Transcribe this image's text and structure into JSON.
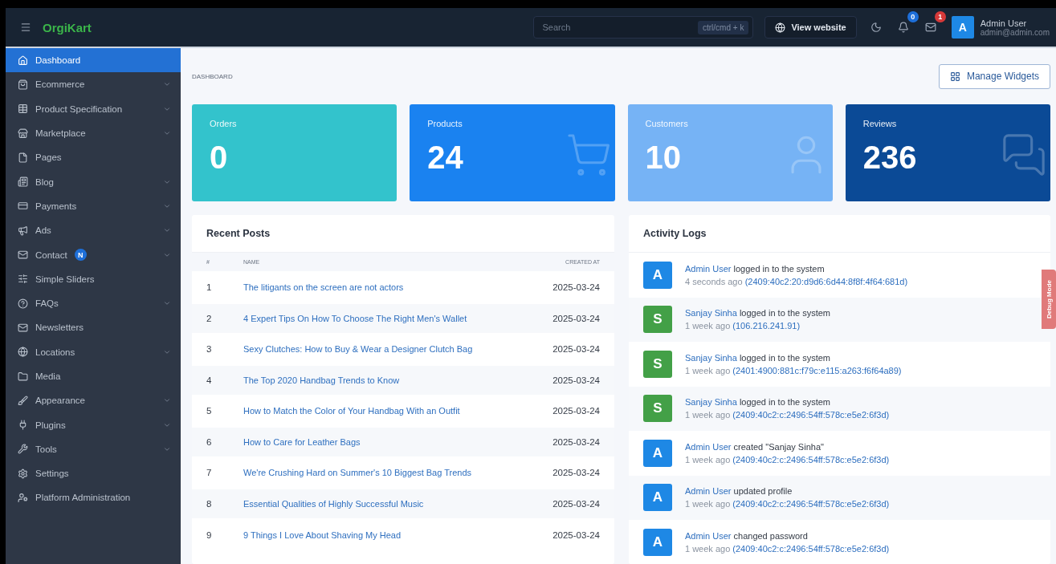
{
  "header": {
    "logo": "OrgiKart",
    "search": {
      "placeholder": "Search",
      "shortcut": "ctrl/cmd + k"
    },
    "view_website": "View website",
    "notifications_badge": "0",
    "messages_badge": "1",
    "user": {
      "avatar": "A",
      "name": "Admin User",
      "email": "admin@admin.com"
    }
  },
  "sidebar": {
    "items": [
      {
        "label": "Dashboard",
        "selected": true,
        "expandable": false
      },
      {
        "label": "Ecommerce",
        "selected": false,
        "expandable": true
      },
      {
        "label": "Product Specification",
        "selected": false,
        "expandable": true
      },
      {
        "label": "Marketplace",
        "selected": false,
        "expandable": true
      },
      {
        "label": "Pages",
        "selected": false,
        "expandable": false
      },
      {
        "label": "Blog",
        "selected": false,
        "expandable": true
      },
      {
        "label": "Payments",
        "selected": false,
        "expandable": true
      },
      {
        "label": "Ads",
        "selected": false,
        "expandable": true
      },
      {
        "label": "Contact",
        "selected": false,
        "expandable": true,
        "badge": "N"
      },
      {
        "label": "Simple Sliders",
        "selected": false,
        "expandable": false
      },
      {
        "label": "FAQs",
        "selected": false,
        "expandable": true
      },
      {
        "label": "Newsletters",
        "selected": false,
        "expandable": false
      },
      {
        "label": "Locations",
        "selected": false,
        "expandable": true
      },
      {
        "label": "Media",
        "selected": false,
        "expandable": false
      },
      {
        "label": "Appearance",
        "selected": false,
        "expandable": true
      },
      {
        "label": "Plugins",
        "selected": false,
        "expandable": true
      },
      {
        "label": "Tools",
        "selected": false,
        "expandable": true
      },
      {
        "label": "Settings",
        "selected": false,
        "expandable": false
      },
      {
        "label": "Platform Administration",
        "selected": false,
        "expandable": false
      }
    ]
  },
  "breadcrumb": "DASHBOARD",
  "manage_widgets": "Manage Widgets",
  "stats": [
    {
      "label": "Orders",
      "value": "0",
      "color": "#33c3cc"
    },
    {
      "label": "Products",
      "value": "24",
      "color": "#1a82f0"
    },
    {
      "label": "Customers",
      "value": "10",
      "color": "#76b3f5"
    },
    {
      "label": "Reviews",
      "value": "236",
      "color": "#0b4a96"
    }
  ],
  "recent_posts": {
    "title": "Recent Posts",
    "columns": [
      "#",
      "NAME",
      "CREATED AT"
    ],
    "rows": [
      [
        "1",
        "The litigants on the screen are not actors",
        "2025-03-24"
      ],
      [
        "2",
        "4 Expert Tips On How To Choose The Right Men's Wallet",
        "2025-03-24"
      ],
      [
        "3",
        "Sexy Clutches: How to Buy & Wear a Designer Clutch Bag",
        "2025-03-24"
      ],
      [
        "4",
        "The Top 2020 Handbag Trends to Know",
        "2025-03-24"
      ],
      [
        "5",
        "How to Match the Color of Your Handbag With an Outfit",
        "2025-03-24"
      ],
      [
        "6",
        "How to Care for Leather Bags",
        "2025-03-24"
      ],
      [
        "7",
        "We're Crushing Hard on Summer's 10 Biggest Bag Trends",
        "2025-03-24"
      ],
      [
        "8",
        "Essential Qualities of Highly Successful Music",
        "2025-03-24"
      ],
      [
        "9",
        "9 Things I Love About Shaving My Head",
        "2025-03-24"
      ]
    ]
  },
  "activity_logs": {
    "title": "Activity Logs",
    "items": [
      {
        "avatar": "A",
        "color": "#1e88e5",
        "user": "Admin User",
        "action": "logged in to the system",
        "time": "4 seconds ago",
        "ip": "(2409:40c2:20:d9d6:6d44:8f8f:4f64:681d)"
      },
      {
        "avatar": "S",
        "color": "#43a047",
        "user": "Sanjay Sinha",
        "action": "logged in to the system",
        "time": "1 week ago",
        "ip": "(106.216.241.91)"
      },
      {
        "avatar": "S",
        "color": "#43a047",
        "user": "Sanjay Sinha",
        "action": "logged in to the system",
        "time": "1 week ago",
        "ip": "(2401:4900:881c:f79c:e115:a263:f6f64a89)"
      },
      {
        "avatar": "S",
        "color": "#43a047",
        "user": "Sanjay Sinha",
        "action": "logged in to the system",
        "time": "1 week ago",
        "ip": "(2409:40c2:c:2496:54ff:578c:e5e2:6f3d)"
      },
      {
        "avatar": "A",
        "color": "#1e88e5",
        "user": "Admin User",
        "action": "created \"Sanjay Sinha\"",
        "time": "1 week ago",
        "ip": "(2409:40c2:c:2496:54ff:578c:e5e2:6f3d)"
      },
      {
        "avatar": "A",
        "color": "#1e88e5",
        "user": "Admin User",
        "action": "updated profile",
        "time": "1 week ago",
        "ip": "(2409:40c2:c:2496:54ff:578c:e5e2:6f3d)"
      },
      {
        "avatar": "A",
        "color": "#1e88e5",
        "user": "Admin User",
        "action": "changed password",
        "time": "1 week ago",
        "ip": "(2409:40c2:c:2496:54ff:578c:e5e2:6f3d)"
      }
    ]
  },
  "debug_tab": "Debug Mode"
}
